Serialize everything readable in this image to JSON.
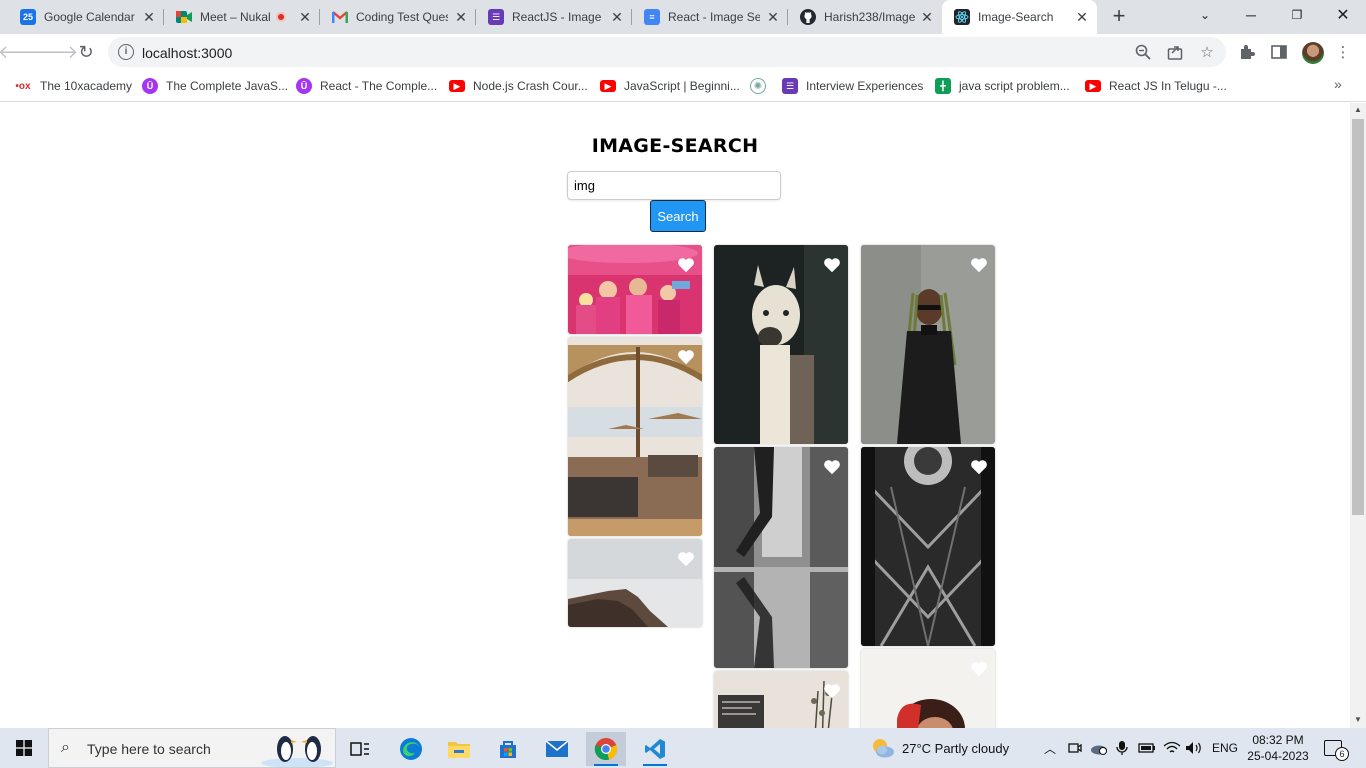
{
  "browser": {
    "tabs": [
      {
        "title": "Google Calendar",
        "icon": "google-calendar-icon",
        "icon_text": "25",
        "color": "#1a73e8"
      },
      {
        "title": "Meet – Nukal",
        "icon": "google-meet-icon",
        "icon_text": "",
        "color": "#00897b",
        "recording": true
      },
      {
        "title": "Coding Test Ques",
        "icon": "gmail-icon",
        "icon_text": "M",
        "color": "#ea4335"
      },
      {
        "title": "ReactJS - Image S",
        "icon": "forms-icon",
        "icon_text": "",
        "color": "#673ab7"
      },
      {
        "title": "React - Image Se",
        "icon": "docs-icon",
        "icon_text": "",
        "color": "#4285f4"
      },
      {
        "title": "Harish238/Image",
        "icon": "github-icon",
        "icon_text": "",
        "color": "#24292f"
      },
      {
        "title": "Image-Search",
        "icon": "react-icon",
        "icon_text": "",
        "color": "#20232a",
        "active": true
      }
    ],
    "url": "localhost:3000",
    "bookmarks": [
      {
        "label": "The 10xacademy",
        "icon": "10x-icon",
        "color": "#d32f2f"
      },
      {
        "label": "The Complete JavaS...",
        "icon": "udemy-icon",
        "color": "#a435f0"
      },
      {
        "label": "React - The Comple...",
        "icon": "udemy-icon",
        "color": "#a435f0"
      },
      {
        "label": "Node.js Crash Cour...",
        "icon": "youtube-icon",
        "color": "#ff0000"
      },
      {
        "label": "JavaScript | Beginni...",
        "icon": "youtube-icon",
        "color": "#ff0000"
      },
      {
        "label": "",
        "icon": "chatgpt-icon",
        "color": "#74aa9c"
      },
      {
        "label": "Interview Experiences",
        "icon": "forms-icon",
        "color": "#673ab7"
      },
      {
        "label": "java script problem...",
        "icon": "sheets-icon",
        "color": "#0f9d58"
      },
      {
        "label": "React JS In Telugu -...",
        "icon": "youtube-icon",
        "color": "#ff0000"
      }
    ]
  },
  "page": {
    "title": "IMAGE-SEARCH",
    "search_value": "img",
    "search_button": "Search",
    "accent": "#2196f3"
  },
  "images": [
    {
      "subject": "people-in-pink-boat",
      "liked": false
    },
    {
      "subject": "llama-portrait",
      "liked": false
    },
    {
      "subject": "woman-with-braids",
      "liked": false
    },
    {
      "subject": "beach-umbrellas",
      "liked": false
    },
    {
      "subject": "city-street-reflection",
      "liked": false
    },
    {
      "subject": "cathedral-ceiling",
      "liked": false
    },
    {
      "subject": "foggy-cliff",
      "liked": false
    },
    {
      "subject": "laptop-and-plant",
      "liked": false
    },
    {
      "subject": "portrait-red-hair",
      "liked": false
    }
  ],
  "taskbar": {
    "search_placeholder": "Type here to search",
    "weather": "27°C  Partly cloudy",
    "language": "ENG",
    "time": "08:32 PM",
    "date": "25-04-2023",
    "notification_count": "6"
  }
}
